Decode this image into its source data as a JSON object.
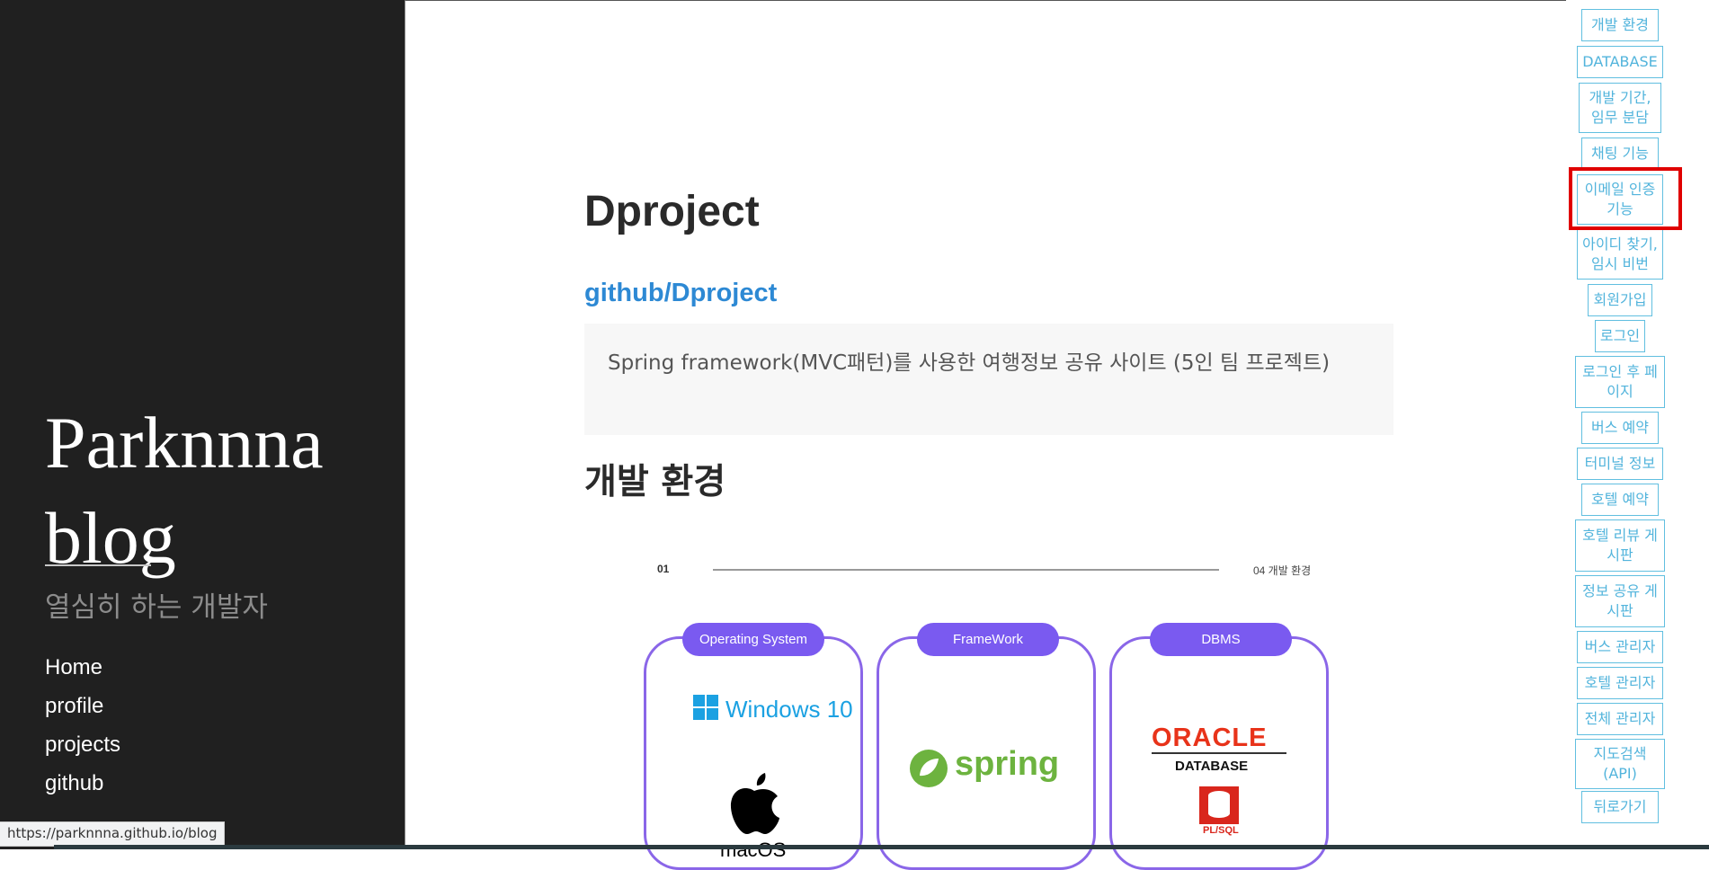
{
  "sidebar": {
    "title_line1": "Parknnna",
    "title_line2": "blog",
    "subtitle": "열심히 하는 개발자",
    "nav": [
      "Home",
      "profile",
      "projects",
      "github"
    ]
  },
  "status_bar": {
    "url": "https://parknnna.github.io/blog"
  },
  "main": {
    "title": "Dproject",
    "repo_link": "github/Dproject",
    "description": "Spring framework(MVC패턴)를 사용한 여행정보 공유 사이트 (5인 팀 프로젝트)",
    "section_heading": "개발 환경",
    "slide": {
      "number": "01",
      "label": "04 개발 환경",
      "cards": [
        {
          "pill": "Operating System",
          "items": [
            "Windows 10",
            "macOS"
          ]
        },
        {
          "pill": "FrameWork",
          "items": [
            "spring"
          ]
        },
        {
          "pill": "DBMS",
          "items": [
            "ORACLE",
            "DATABASE",
            "PL/SQL"
          ]
        }
      ]
    }
  },
  "toc": [
    "개발 환경",
    "DATABASE",
    "개발 기간, 임무 분담",
    "채팅 기능",
    "이메일 인증 기능",
    "아이디 찾기, 임시 비번",
    "회원가입",
    "로그인",
    "로그인 후 페이지",
    "버스 예약",
    "터미널 정보",
    "호텔 예약",
    "호텔 리뷰 게시판",
    "정보 공유 게시판",
    "버스 관리자",
    "호텔 관리자",
    "전체 관리자",
    "지도검색(API)",
    "뒤로가기"
  ],
  "highlighted_toc_item": "이메일 인증 기능",
  "colors": {
    "sidebar_bg": "#202020",
    "link_blue": "#2d89d4",
    "toc_border": "#61bfe0",
    "card_purple": "#7a5af0",
    "highlight_red": "#e00000"
  }
}
